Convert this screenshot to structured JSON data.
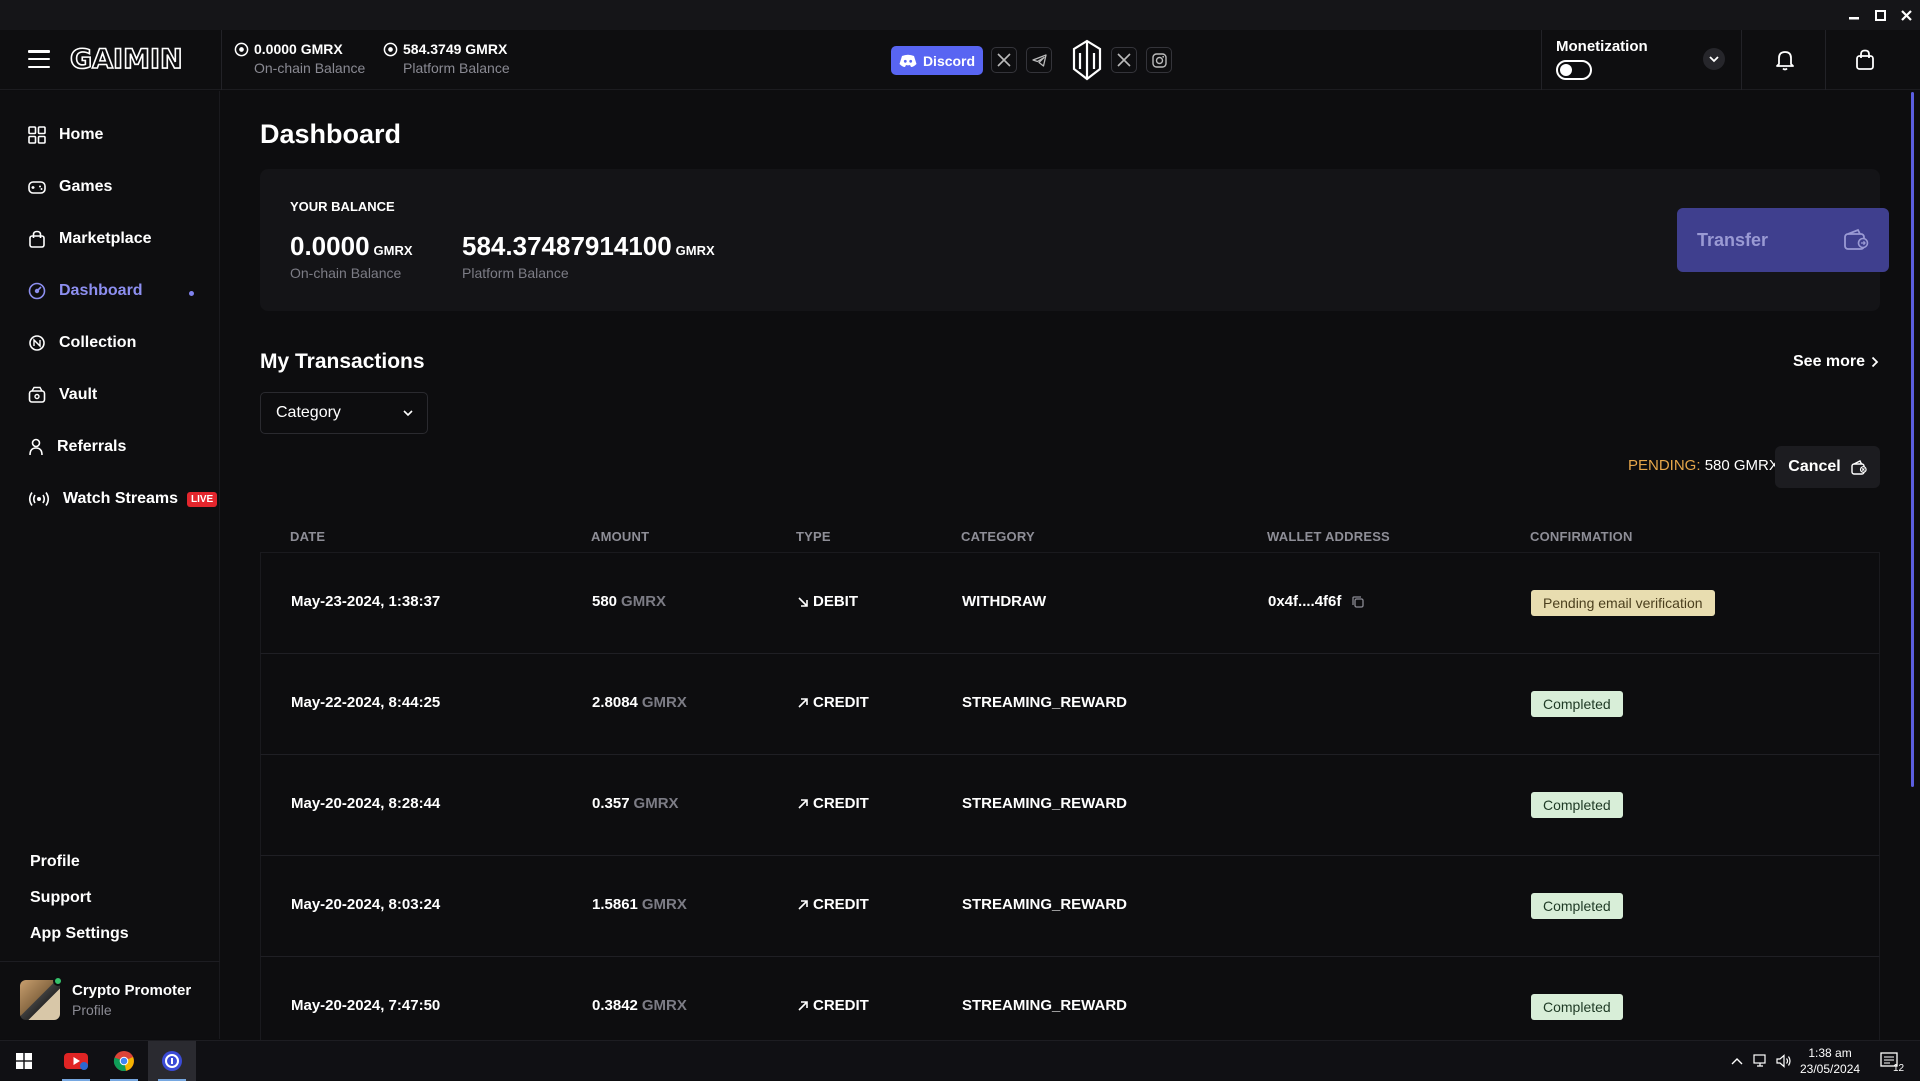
{
  "window": {
    "minimize_icon": "minimize-icon",
    "maximize_icon": "maximize-icon",
    "close_icon": "close-icon"
  },
  "header": {
    "logo": "GAIMIN",
    "balances": [
      {
        "value": "0.0000 GMRX",
        "label": "On-chain Balance"
      },
      {
        "value": "584.3749 GMRX",
        "label": "Platform Balance"
      }
    ],
    "discord_label": "Discord",
    "monetization_label": "Monetization",
    "monetization_enabled": false
  },
  "sidebar": {
    "items": [
      {
        "label": "Home",
        "icon": "grid-icon"
      },
      {
        "label": "Games",
        "icon": "gamepad-icon"
      },
      {
        "label": "Marketplace",
        "icon": "bag-icon"
      },
      {
        "label": "Dashboard",
        "icon": "dashboard-icon",
        "active": true
      },
      {
        "label": "Collection",
        "icon": "collection-icon"
      },
      {
        "label": "Vault",
        "icon": "vault-icon"
      },
      {
        "label": "Referrals",
        "icon": "person-icon"
      },
      {
        "label": "Watch Streams",
        "icon": "broadcast-icon",
        "badge": "LIVE"
      }
    ],
    "links": [
      "Profile",
      "Support",
      "App Settings"
    ],
    "user": {
      "name": "Crypto Promoter",
      "sub": "Profile"
    }
  },
  "main": {
    "title": "Dashboard",
    "balance": {
      "heading": "YOUR BALANCE",
      "onchain": {
        "amount": "0.0000",
        "unit": "GMRX",
        "label": "On-chain Balance"
      },
      "platform": {
        "amount": "584.37487914100",
        "unit": "GMRX",
        "label": "Platform Balance"
      },
      "transfer_label": "Transfer"
    },
    "transactions": {
      "title": "My Transactions",
      "see_more": "See more",
      "category_label": "Category",
      "pending_label": "PENDING:",
      "pending_value": "580 GMRX",
      "cancel_label": "Cancel",
      "columns": [
        "DATE",
        "AMOUNT",
        "TYPE",
        "CATEGORY",
        "WALLET ADDRESS",
        "CONFIRMATION"
      ],
      "rows": [
        {
          "date": "May-23-2024, 1:38:37",
          "amount": "580",
          "unit": "GMRX",
          "type": "DEBIT",
          "category": "WITHDRAW",
          "wallet": "0x4f....4f6f",
          "status": "Pending email verification"
        },
        {
          "date": "May-22-2024, 8:44:25",
          "amount": "2.8084",
          "unit": "GMRX",
          "type": "CREDIT",
          "category": "STREAMING_REWARD",
          "wallet": "",
          "status": "Completed"
        },
        {
          "date": "May-20-2024, 8:28:44",
          "amount": "0.357",
          "unit": "GMRX",
          "type": "CREDIT",
          "category": "STREAMING_REWARD",
          "wallet": "",
          "status": "Completed"
        },
        {
          "date": "May-20-2024, 8:03:24",
          "amount": "1.5861",
          "unit": "GMRX",
          "type": "CREDIT",
          "category": "STREAMING_REWARD",
          "wallet": "",
          "status": "Completed"
        },
        {
          "date": "May-20-2024, 7:47:50",
          "amount": "0.3842",
          "unit": "GMRX",
          "type": "CREDIT",
          "category": "STREAMING_REWARD",
          "wallet": "",
          "status": "Completed"
        }
      ]
    }
  },
  "taskbar": {
    "time": "1:38 am",
    "date": "23/05/2024",
    "notifications": "12"
  },
  "colors": {
    "accent": "#7f82ee",
    "transfer_bg": "#3f3f8e",
    "discord": "#5865f2",
    "pending": "#e5a64a",
    "live": "#e3262d"
  }
}
